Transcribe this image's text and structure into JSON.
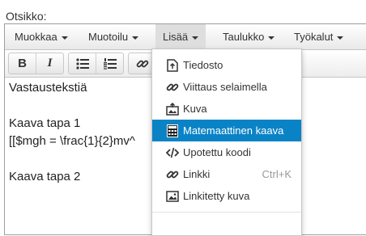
{
  "form": {
    "title_label": "Otsikko:"
  },
  "menubar": {
    "items": [
      {
        "label": "Muokkaa"
      },
      {
        "label": "Muotoilu"
      },
      {
        "label": "Lisää"
      },
      {
        "label": "Taulukko"
      },
      {
        "label": "Työkalut"
      }
    ]
  },
  "toolbar": {
    "bold": "B",
    "italic": "I"
  },
  "content": {
    "lines": [
      "Vastaustekstiä",
      "",
      "Kaava tapa 1",
      "[[$mgh = \\frac{1}{2}mv^",
      "",
      "Kaava tapa 2"
    ]
  },
  "dropdown": {
    "items": [
      {
        "label": "Tiedosto",
        "icon": "file-icon"
      },
      {
        "label": "Viittaus selaimella",
        "icon": "link-icon"
      },
      {
        "label": "Kuva",
        "icon": "image-upload-icon"
      },
      {
        "label": "Matemaattinen kaava",
        "icon": "formula-icon"
      },
      {
        "label": "Upotettu koodi",
        "icon": "code-icon"
      },
      {
        "label": "Linkki",
        "icon": "link-icon",
        "shortcut": "Ctrl+K"
      },
      {
        "label": "Linkitetty kuva",
        "icon": "image-icon"
      }
    ],
    "active_index": 3
  },
  "colors": {
    "highlight": "#0a83c6"
  }
}
